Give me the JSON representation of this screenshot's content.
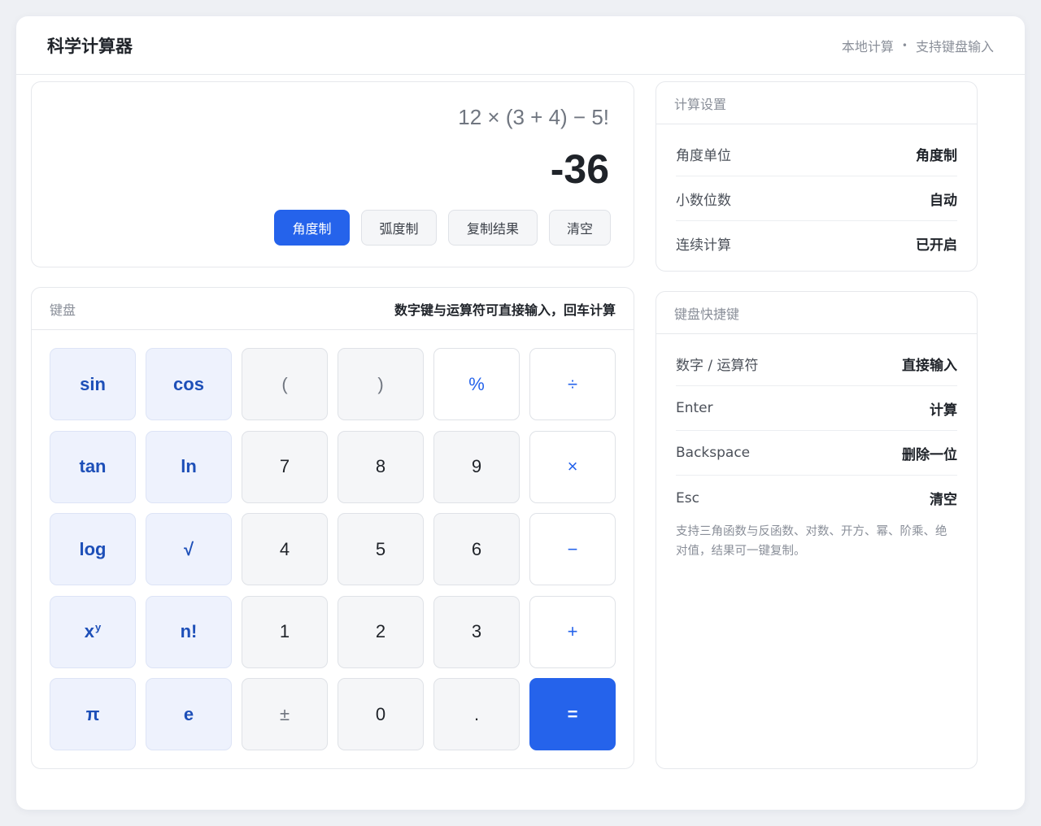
{
  "header": {
    "title": "科学计算器",
    "meta_local": "本地计算",
    "meta_sep": "•",
    "meta_keyboard": "支持键盘输入"
  },
  "display": {
    "expression": "12 × (3 + 4) − 5!",
    "result": "-36",
    "buttons": {
      "degree": "角度制",
      "radian": "弧度制",
      "copy": "复制结果",
      "clear": "清空"
    }
  },
  "keypad": {
    "label": "键盘",
    "hint": "数字键与运算符可直接输入，回车计算",
    "keys": {
      "sin": "sin",
      "cos": "cos",
      "lparen": "(",
      "rparen": ")",
      "percent": "%",
      "divide": "÷",
      "tan": "tan",
      "ln": "ln",
      "seven": "7",
      "eight": "8",
      "nine": "9",
      "multiply": "×",
      "log": "log",
      "sqrt": "√",
      "four": "4",
      "five": "5",
      "six": "6",
      "minus": "−",
      "pow_base": "x",
      "pow_exp": "y",
      "factorial": "n!",
      "one": "1",
      "two": "2",
      "three": "3",
      "plus": "+",
      "pi": "π",
      "e": "e",
      "plusminus": "±",
      "zero": "0",
      "dot": ".",
      "equals": "="
    }
  },
  "settings": {
    "title": "计算设置",
    "rows": [
      {
        "key": "角度单位",
        "value": "角度制"
      },
      {
        "key": "小数位数",
        "value": "自动"
      },
      {
        "key": "连续计算",
        "value": "已开启"
      }
    ]
  },
  "shortcuts": {
    "title": "键盘快捷键",
    "rows": [
      {
        "key": "数字 / 运算符",
        "value": "直接输入"
      },
      {
        "key": "Enter",
        "value": "计算"
      },
      {
        "key": "Backspace",
        "value": "删除一位"
      },
      {
        "key": "Esc",
        "value": "清空"
      }
    ],
    "note": "支持三角函数与反函数、对数、开方、幂、阶乘、绝对值，结果可一键复制。"
  },
  "colors": {
    "accent": "#2563eb",
    "fn_key_bg": "#eef2fd",
    "background": "#eef0f4"
  }
}
